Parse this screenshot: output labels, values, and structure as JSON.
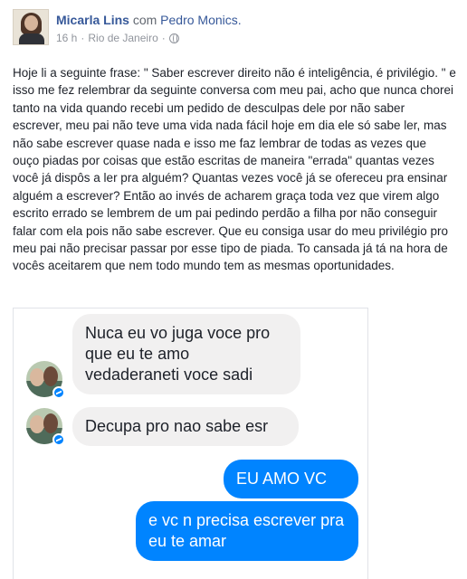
{
  "post": {
    "author": "Micarla Lins",
    "with_word": "com",
    "tagged": "Pedro Monics.",
    "time": "16 h",
    "separator": "·",
    "location": "Rio de Janeiro",
    "privacy_icon": "globe-icon",
    "text": "Hoje li a seguinte frase: \" Saber escrever direito não é inteligência, é privilégio. \" e isso me fez relembrar da seguinte conversa com meu pai, acho que nunca chorei tanto na vida quando recebi um pedido de desculpas dele por não saber escrever, meu pai não teve uma vida nada fácil hoje em dia ele só sabe ler, mas não sabe escrever quase nada e isso me faz lembrar de todas as vezes que ouço piadas por coisas que estão escritas de maneira \"errada\" quantas vezes você já dispôs a ler pra alguém? Quantas vezes você já se ofereceu pra ensinar alguém a escrever? Então ao invés de acharem graça toda vez que virem algo escrito errado se lembrem de um pai pedindo perdão a filha por não conseguir falar com ela pois não sabe escrever. Que eu consiga usar do meu privilégio pro meu pai não precisar passar por esse tipo de piada. To cansada já tá na hora de vocês aceitarem que nem todo mundo tem as mesmas oportunidades."
  },
  "chat": {
    "messages": [
      {
        "from": "other",
        "text": "Nuca eu vo juga voce pro que eu te amo vedaderaneti voce sadi"
      },
      {
        "from": "other",
        "text": "Decupa pro nao sabe esr"
      },
      {
        "from": "me",
        "text": "EU AMO VC"
      },
      {
        "from": "me",
        "text": "e vc n precisa escrever pra eu te amar"
      }
    ]
  },
  "colors": {
    "link": "#365899",
    "meta": "#90949c",
    "incoming_bubble": "#f1f0f0",
    "outgoing_bubble": "#0084ff"
  }
}
